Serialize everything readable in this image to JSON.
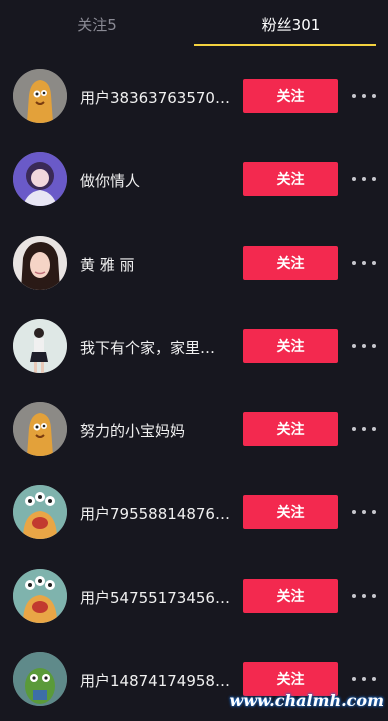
{
  "tabs": [
    {
      "label": "关注5",
      "active": false
    },
    {
      "label": "粉丝301",
      "active": true
    }
  ],
  "follow_label": "关注",
  "users": [
    {
      "name": "用户38363763570…",
      "avatar": "orange-monster-avatar"
    },
    {
      "name": "做你情人",
      "avatar": "girl-photo-avatar"
    },
    {
      "name": "黄 雅 丽",
      "avatar": "woman-photo-avatar"
    },
    {
      "name": "我下有个家，家里…",
      "avatar": "standing-person-avatar"
    },
    {
      "name": "努力的小宝妈妈",
      "avatar": "orange-monster-avatar"
    },
    {
      "name": "用户79558814876…",
      "avatar": "three-eyed-monster-avatar"
    },
    {
      "name": "用户54755173456…",
      "avatar": "three-eyed-monster-avatar"
    },
    {
      "name": "用户14874174958…",
      "avatar": "green-alien-avatar"
    }
  ],
  "watermark": "www.chalmh.com",
  "colors": {
    "accent": "#f3294f",
    "tab_indicator": "#f3d23f",
    "background": "#17171f"
  }
}
